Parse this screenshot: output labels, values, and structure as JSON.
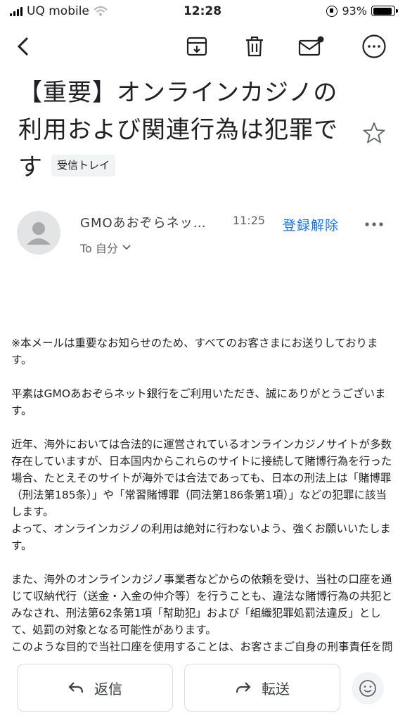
{
  "status_bar": {
    "carrier": "UQ mobile",
    "time": "12:28",
    "battery_percent": "93%",
    "battery_level": 0.93
  },
  "toolbar": {
    "icons": [
      "back-arrow-icon",
      "archive-icon",
      "trash-icon",
      "mark-unread-icon",
      "more-options-icon"
    ]
  },
  "email": {
    "subject": "【重要】オンラインカジノの利用および関連行為は犯罪です",
    "label": "受信トレイ",
    "sender_name": "GMOあおぞらネッ…",
    "time": "11:25",
    "unsubscribe": "登録解除",
    "to_line": "To 自分",
    "body": {
      "p1": "※本メールは重要なお知らせのため、すべてのお客さまにお送りしております。",
      "p2": "平素はGMOあおぞらネット銀行をご利用いただき、誠にありがとうございます。",
      "p3a": "近年、海外においては合法的に運営されているオンラインカジノサイトが多数存在していますが、日本国内からこれらのサイトに接続して賭博行為を行った場合、たとえそのサイトが海外では合法であっても、日本の刑法上は「賭博罪（刑法第185条）」や「常習賭博罪（同法第186条第1項）」などの犯罪に該当します。",
      "p3b": "よって、オンラインカジノの利用は絶対に行わないよう、強くお願いいたします。",
      "p4a": "また、海外のオンラインカジノ事業者などからの依頼を受け、当社の口座を通じて収納代行（送金・入金の仲介等）を行うことも、違法な賭博行為の共犯とみなされ、刑法第62条第1項「幇助犯」および「組織犯罪処罰法違反」として、処罰の対象となる可能性があります。",
      "p4b": "このような目的で当社口座を使用することは、お客さまご自身の刑事責任を問われる重大なリスクを伴いますので、決して行わないでくださ"
    }
  },
  "actions": {
    "reply": "返信",
    "forward": "転送"
  },
  "colors": {
    "accent": "#1a73e8",
    "chip_bg": "#f1f3f4",
    "border": "#dadce0"
  }
}
